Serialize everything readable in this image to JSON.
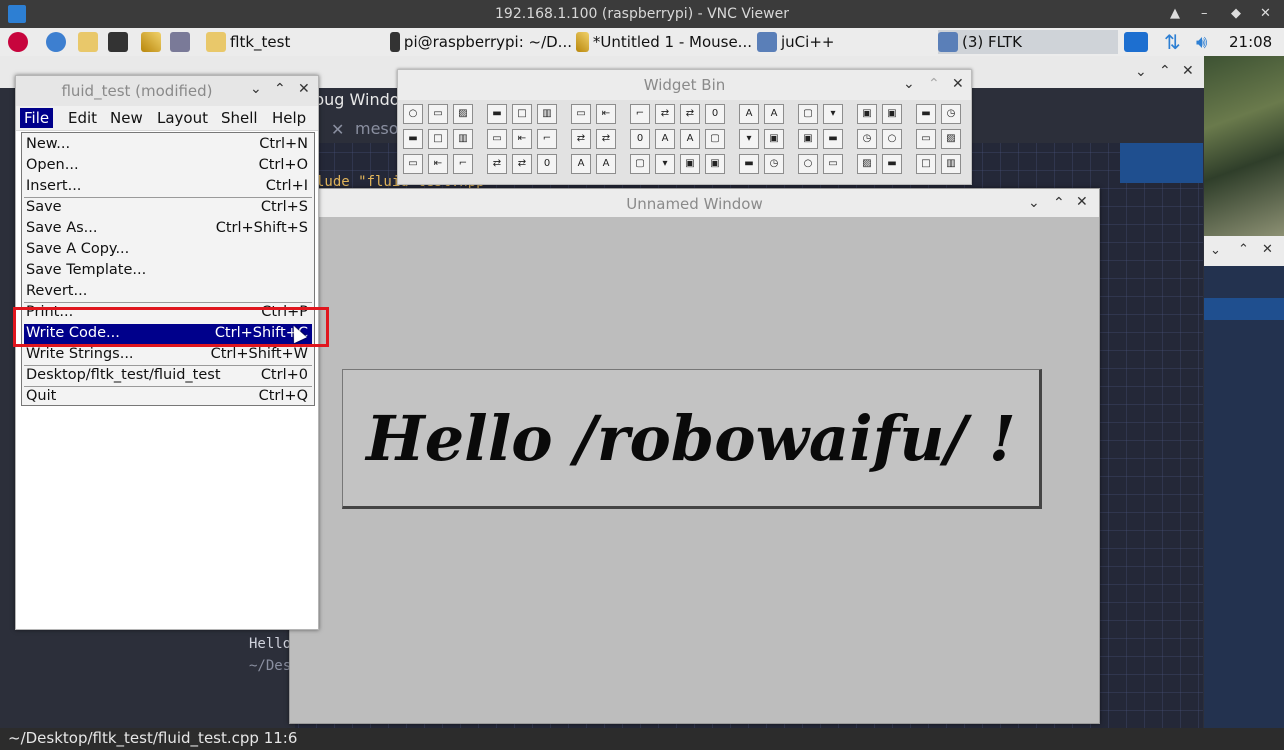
{
  "vnc": {
    "title": "192.168.1.100 (raspberrypi) - VNC Viewer",
    "min": "▲",
    "restore": "–",
    "max": "◆",
    "close": "✕"
  },
  "taskbar": {
    "items": [
      "fltk_test",
      "pi@raspberrypi: ~/D...",
      "*Untitled 1 - Mouse...",
      "juCi++",
      "(3) FLTK"
    ],
    "clock": "21:08"
  },
  "editor": {
    "menu_fragment": "bug  Windo",
    "tab_fragment": "meso",
    "code_line": "lude \"fluid_test.hpp\"",
    "out1": "Hello",
    "out2": "~/Des",
    "status": "~/Desktop/fltk_test/fluid_test.cpp 11:6"
  },
  "fluid": {
    "title": "fluid_test (modified)",
    "menubar": [
      "File",
      "Edit",
      "New",
      "Layout",
      "Shell",
      "Help"
    ],
    "file_menu": [
      {
        "label": "New...",
        "shortcut": "Ctrl+N"
      },
      {
        "label": "Open...",
        "shortcut": "Ctrl+O"
      },
      {
        "label": "Insert...",
        "shortcut": "Ctrl+I"
      },
      {
        "label": "Save",
        "shortcut": "Ctrl+S"
      },
      {
        "label": "Save As...",
        "shortcut": "Ctrl+Shift+S"
      },
      {
        "label": "Save A Copy...",
        "shortcut": ""
      },
      {
        "label": "Save Template...",
        "shortcut": ""
      },
      {
        "label": "Revert...",
        "shortcut": ""
      },
      {
        "label": "Print...",
        "shortcut": "Ctrl+P"
      },
      {
        "label": "Write Code...",
        "shortcut": "Ctrl+Shift+C"
      },
      {
        "label": "Write Strings...",
        "shortcut": "Ctrl+Shift+W"
      },
      {
        "label": "Desktop/fltk_test/fluid_test",
        "shortcut": "Ctrl+0"
      },
      {
        "label": "Quit",
        "shortcut": "Ctrl+Q"
      }
    ]
  },
  "widget_bin": {
    "title": "Widget Bin"
  },
  "unnamed": {
    "title": "Unnamed Window",
    "hello": "Hello /robowaifu/ !"
  },
  "colors": {
    "menu_highlight": "#00008b",
    "annotation_box": "#e0161e"
  }
}
